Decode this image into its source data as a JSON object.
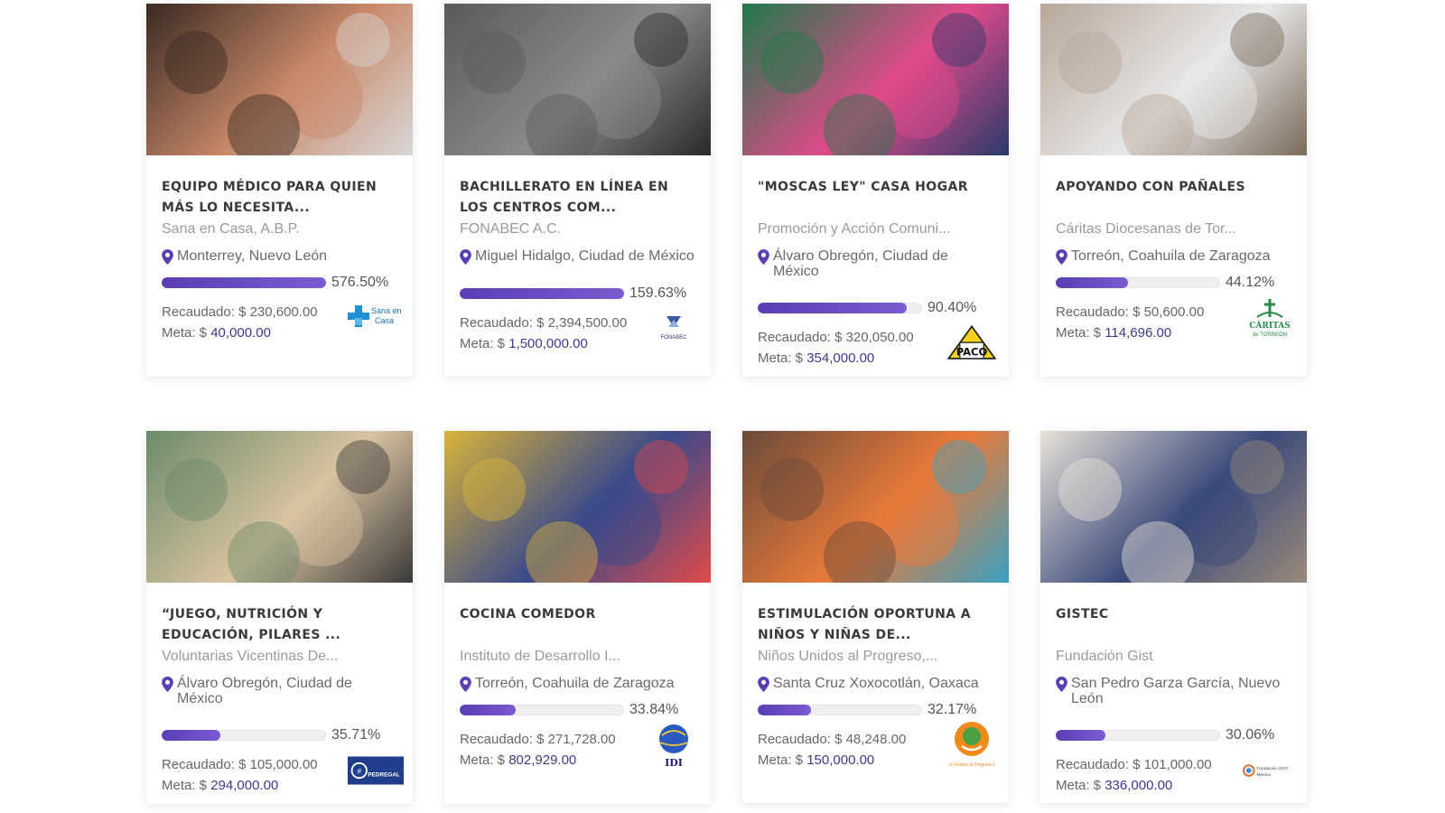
{
  "labels": {
    "raised": "Recaudado: $ ",
    "goal": "Meta: $ "
  },
  "cards": [
    {
      "title": "EQUIPO MÉDICO PARA QUIEN MÁS LO NECESITA...",
      "org": "Sana en Casa, A.B.P.",
      "location": "Monterrey, Nuevo León",
      "percent_label": "576.50%",
      "progress": 1.0,
      "raised": "230,600.00",
      "goal": "40,000.00",
      "logo_text": "Sana en Casa",
      "logo_icon": "medical-cross-icon",
      "photo_colors": [
        "#3a2a22",
        "#c98a6a",
        "#d8d8d8"
      ]
    },
    {
      "title": "BACHILLERATO EN LÍNEA EN LOS CENTROS COM...",
      "org": "FONABEC A.C.",
      "location": "Miguel Hidalgo, Ciudad de México",
      "percent_label": "159.63%",
      "progress": 1.0,
      "raised": "2,394,500.00",
      "goal": "1,500,000.00",
      "logo_text": "FONABEC",
      "logo_icon": "fonabec-logo-icon",
      "photo_colors": [
        "#5a5a5a",
        "#8a8a8a",
        "#2a2a2a"
      ]
    },
    {
      "title": "\"MOSCAS LEY\" CASA HOGAR",
      "org": "Promoción y Acción Comuni...",
      "location": "Álvaro Obregón, Ciudad de México",
      "percent_label": "90.40%",
      "progress": 0.904,
      "raised": "320,050.00",
      "goal": "354,000.00",
      "logo_text": "PACO",
      "logo_icon": "paco-house-icon",
      "photo_colors": [
        "#1f7a4a",
        "#e04a8a",
        "#2a3a6a"
      ]
    },
    {
      "title": "APOYANDO CON PAÑALES",
      "org": "Cáritas Diocesanas de Tor...",
      "location": "Torreón, Coahuila de Zaragoza",
      "percent_label": "44.12%",
      "progress": 0.4412,
      "raised": "50,600.00",
      "goal": "114,696.00",
      "logo_text": "CÁRITAS de TORREÓN",
      "logo_icon": "caritas-cross-icon",
      "photo_colors": [
        "#b8a79a",
        "#e8e8e8",
        "#7a6a5a"
      ]
    },
    {
      "title": "“JUEGO, NUTRICIÓN Y EDUCACIÓN, PILARES ...",
      "org": "Voluntarias Vicentinas De...",
      "location": "Álvaro Obregón, Ciudad de México",
      "percent_label": "35.71%",
      "progress": 0.3571,
      "raised": "105,000.00",
      "goal": "294,000.00",
      "logo_text": "PEDREGAL",
      "logo_icon": "pedregal-logo-icon",
      "photo_colors": [
        "#6a8a6a",
        "#d9c3a0",
        "#3a3a3a"
      ]
    },
    {
      "title": "COCINA COMEDOR",
      "org": "Instituto de Desarrollo I...",
      "location": "Torreón, Coahuila de Zaragoza",
      "percent_label": "33.84%",
      "progress": 0.3384,
      "raised": "271,728.00",
      "goal": "802,929.00",
      "logo_text": "IDI",
      "logo_icon": "idi-globe-icon",
      "photo_colors": [
        "#d9b43a",
        "#3a4a8a",
        "#e04a4a"
      ]
    },
    {
      "title": "ESTIMULACIÓN OPORTUNA A NIÑOS Y NIÑAS DE...",
      "org": "Niños Unidos al Progreso,...",
      "location": "Santa Cruz Xoxocotlán, Oaxaca",
      "percent_label": "32.17%",
      "progress": 0.3217,
      "raised": "48,248.00",
      "goal": "150,000.00",
      "logo_text": "Niños Unidos al Progreso B.C.",
      "logo_icon": "tree-hands-icon",
      "photo_colors": [
        "#6a4a3a",
        "#e87a3a",
        "#3aa0c0"
      ]
    },
    {
      "title": "GISTEC",
      "org": "Fundación Gist",
      "location": "San Pedro Garza García, Nuevo León",
      "percent_label": "30.06%",
      "progress": 0.3006,
      "raised": "101,000.00",
      "goal": "336,000.00",
      "logo_text": "Fundación GIST México",
      "logo_icon": "gist-swirl-icon",
      "photo_colors": [
        "#e8e2d8",
        "#3a4a7a",
        "#9a8a7a"
      ]
    }
  ]
}
